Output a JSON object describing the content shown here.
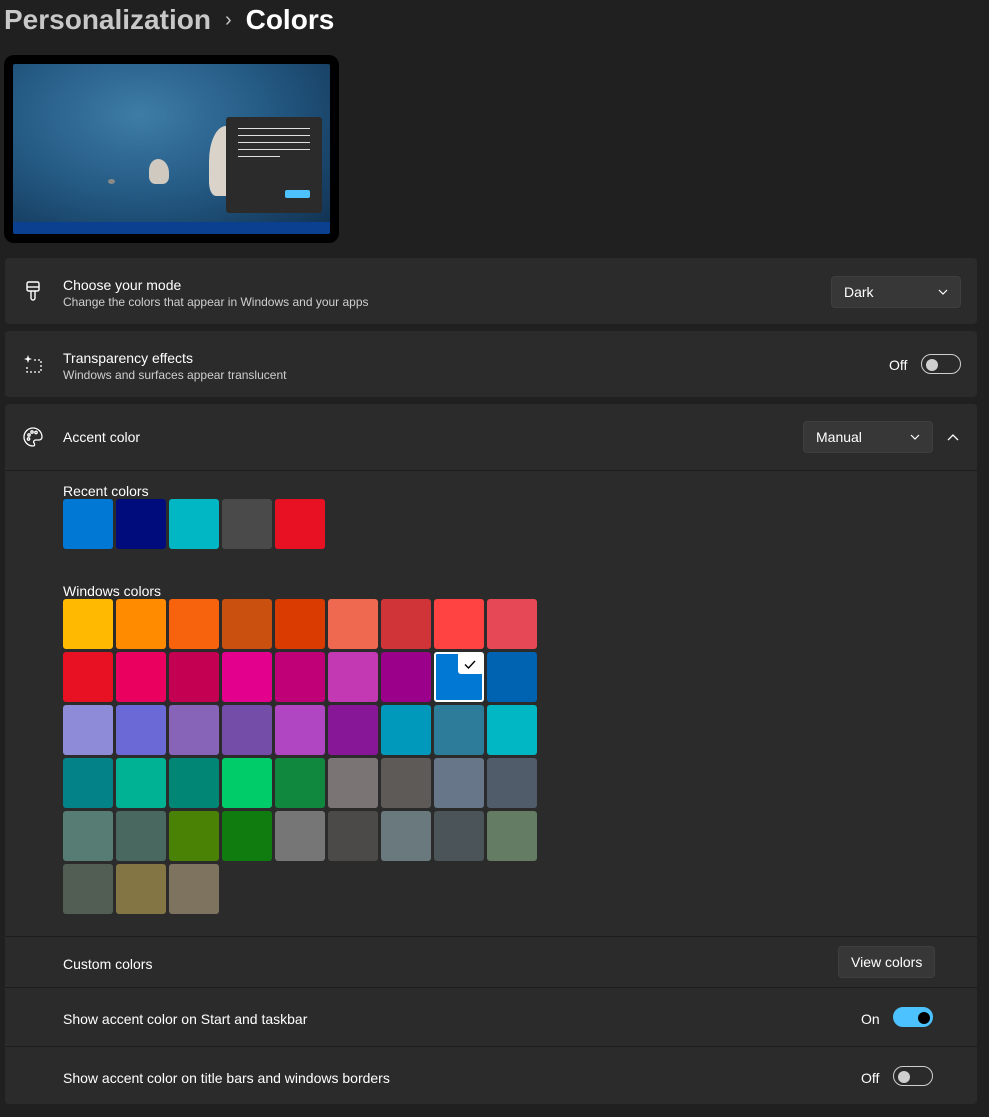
{
  "breadcrumb": {
    "parent": "Personalization",
    "separator": "›",
    "current": "Colors"
  },
  "mode": {
    "title": "Choose your mode",
    "subtitle": "Change the colors that appear in Windows and your apps",
    "value": "Dark",
    "icon": "paintbrush-icon"
  },
  "transparency": {
    "title": "Transparency effects",
    "subtitle": "Windows and surfaces appear translucent",
    "state_label": "Off",
    "on": false,
    "icon": "sparkle-icon"
  },
  "accent": {
    "title": "Accent color",
    "value": "Manual",
    "icon": "palette-icon",
    "expanded": true
  },
  "recent_colors": {
    "label": "Recent colors",
    "colors": [
      "#0078d4",
      "#000c7b",
      "#00b7c3",
      "#4a4a4a",
      "#e81123"
    ]
  },
  "windows_colors": {
    "label": "Windows colors",
    "selected_index": 16,
    "colors": [
      "#ffb900",
      "#ff8c00",
      "#f7630c",
      "#ca5010",
      "#da3b01",
      "#ef6950",
      "#d13438",
      "#ff4343",
      "#e74856",
      "#e81123",
      "#ea005e",
      "#c30052",
      "#e3008c",
      "#bf0077",
      "#c239b3",
      "#9a0089",
      "#0078d4",
      "#0063b1",
      "#8e8cd8",
      "#6b69d6",
      "#8764b8",
      "#744da9",
      "#b146c2",
      "#881798",
      "#0099bc",
      "#2d7d9a",
      "#00b7c3",
      "#038387",
      "#00b294",
      "#018574",
      "#00cc6a",
      "#10893e",
      "#7a7574",
      "#5d5a58",
      "#68768a",
      "#515c6b",
      "#567c73",
      "#486860",
      "#498205",
      "#107c10",
      "#767676",
      "#4c4a48",
      "#69797e",
      "#4a5459",
      "#647c64",
      "#525e54",
      "#847545",
      "#7e735f"
    ]
  },
  "custom_colors": {
    "label": "Custom colors",
    "button": "View colors"
  },
  "show_start": {
    "label": "Show accent color on Start and taskbar",
    "state_label": "On",
    "on": true
  },
  "show_title": {
    "label": "Show accent color on title bars and windows borders",
    "state_label": "Off",
    "on": false
  }
}
